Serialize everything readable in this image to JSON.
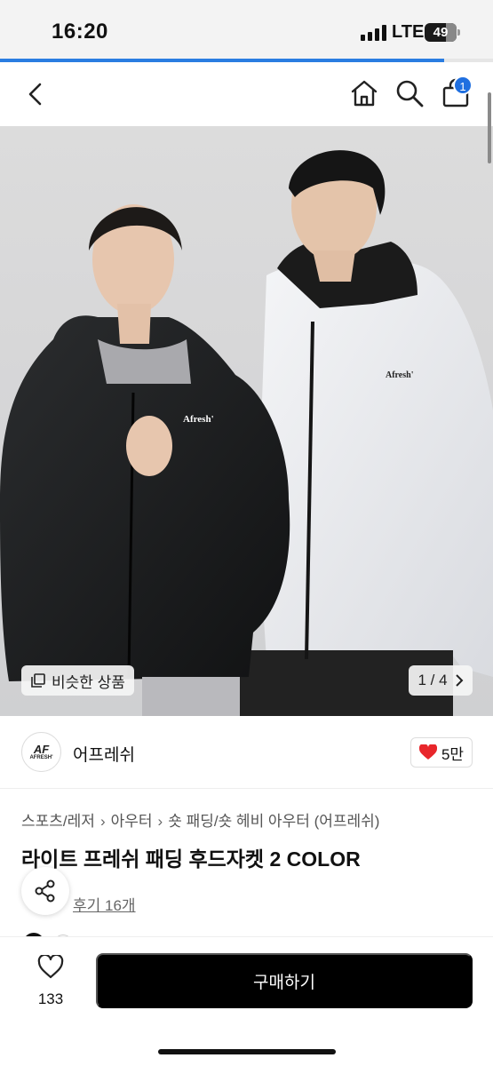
{
  "status_bar": {
    "time": "16:20",
    "network": "LTE",
    "battery": "49"
  },
  "page_progress": 0.9,
  "nav": {
    "back_icon": "chevron-left-icon",
    "home_icon": "home-icon",
    "search_icon": "search-icon",
    "cart_icon": "shopping-bag-icon",
    "cart_badge": "1"
  },
  "hero": {
    "similar_label": "비슷한 상품",
    "pager": "1 / 4",
    "jacket_logo": "Afresh'"
  },
  "store": {
    "logo_text": "AFRESH'",
    "logo_mark": "AF",
    "name": "어프레쉬",
    "likes": "5만"
  },
  "breadcrumb": [
    "스포츠/레저",
    "아우터",
    "숏 패딩/숏 헤비 아우터 (어프레쉬)"
  ],
  "product": {
    "title": "라이트 프레쉬 패딩 후드자켓 2 COLOR",
    "review_link": "후기 16개"
  },
  "bottom_bar": {
    "wish_count": "133",
    "buy_label": "구매하기"
  },
  "colors": {
    "accent": "#1f6fe0",
    "like_heart": "#e8262b",
    "buy_bg": "#000000"
  }
}
